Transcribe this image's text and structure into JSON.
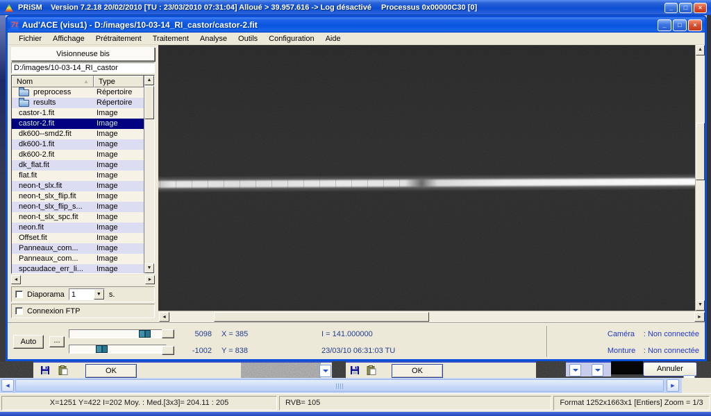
{
  "prism": {
    "app_name": "PRiSM",
    "session_info": "Version 7.2.18   20/02/2010   [TU : 23/03/2010 07:31:04] Alloué > 39.957.616 -> Log désactivé",
    "process_info": "Processus 0x00000C30 [0]"
  },
  "window": {
    "title": "Aud'ACE (visu1) - D:/images/10-03-14_RI_castor/castor-2.fit",
    "menu": {
      "items": [
        "Fichier",
        "Affichage",
        "Prétraitement",
        "Traitement",
        "Analyse",
        "Outils",
        "Configuration",
        "Aide"
      ]
    },
    "viewer": {
      "header": "Visionneuse bis",
      "path": "D:/images/10-03-14_RI_castor",
      "columns": {
        "name": "Nom",
        "type": "Type"
      },
      "rows": [
        {
          "name": "preprocess",
          "type": "Répertoire",
          "icon": "folder"
        },
        {
          "name": "results",
          "type": "Répertoire",
          "icon": "folder"
        },
        {
          "name": "castor-1.fit",
          "type": "Image"
        },
        {
          "name": "castor-2.fit",
          "type": "Image",
          "selected": true
        },
        {
          "name": "dk600--smd2.fit",
          "type": "Image"
        },
        {
          "name": "dk600-1.fit",
          "type": "Image"
        },
        {
          "name": "dk600-2.fit",
          "type": "Image"
        },
        {
          "name": "dk_flat.fit",
          "type": "Image"
        },
        {
          "name": "flat.fit",
          "type": "Image"
        },
        {
          "name": "neon-t_slx.fit",
          "type": "Image"
        },
        {
          "name": "neon-t_slx_flip.fit",
          "type": "Image"
        },
        {
          "name": "neon-t_slx_flip_s...",
          "type": "Image"
        },
        {
          "name": "neon-t_slx_spc.fit",
          "type": "Image"
        },
        {
          "name": "neon.fit",
          "type": "Image"
        },
        {
          "name": "Offset.fit",
          "type": "Image"
        },
        {
          "name": "Panneaux_com...",
          "type": "Image"
        },
        {
          "name": "Panneaux_com...",
          "type": "Image"
        },
        {
          "name": "spcaudace_err_li...",
          "type": "Image"
        }
      ],
      "diaporama": {
        "label": "Diaporama",
        "value": "1",
        "unit": "s."
      },
      "ftp_label": "Connexion FTP"
    },
    "controls": {
      "auto": "Auto",
      "more": "...",
      "high": "5098",
      "low": "-1002"
    },
    "readout": {
      "x": "X = 385",
      "y": "Y = 838",
      "intensity": "I = 141.000000",
      "datetime": "23/03/10 06:31:03 TU"
    },
    "connections": {
      "camera_label": "Caméra",
      "camera_value": ": Non connectée",
      "mount_label": "Monture",
      "mount_value": ": Non connectée"
    }
  },
  "background": {
    "ok_left": "OK",
    "ok_right": "OK",
    "annuler": "Annuler"
  },
  "statusbar": {
    "pixel_info": "X=1251 Y=422 I=202  Moy. : Med.[3x3]= 204.11 : 205",
    "rvb": "RVB= 105",
    "format_info": "Format 1252x1663x1 [Entiers]  Zoom = 1/3"
  },
  "icons": {
    "up": "▲",
    "down": "▼",
    "left": "◄",
    "right": "►",
    "minimize": "_",
    "restore": "□",
    "close": "×",
    "dropdown": "▼",
    "sort_asc": "▲"
  },
  "colors": {
    "titlebar_blue": "#0a50d8",
    "selection_navy": "#000080",
    "readout_text": "#233a8f",
    "connection_text": "#2236c8",
    "panel_beige": "#ece9d8",
    "row_alt_lavender": "#dcdcf2"
  }
}
